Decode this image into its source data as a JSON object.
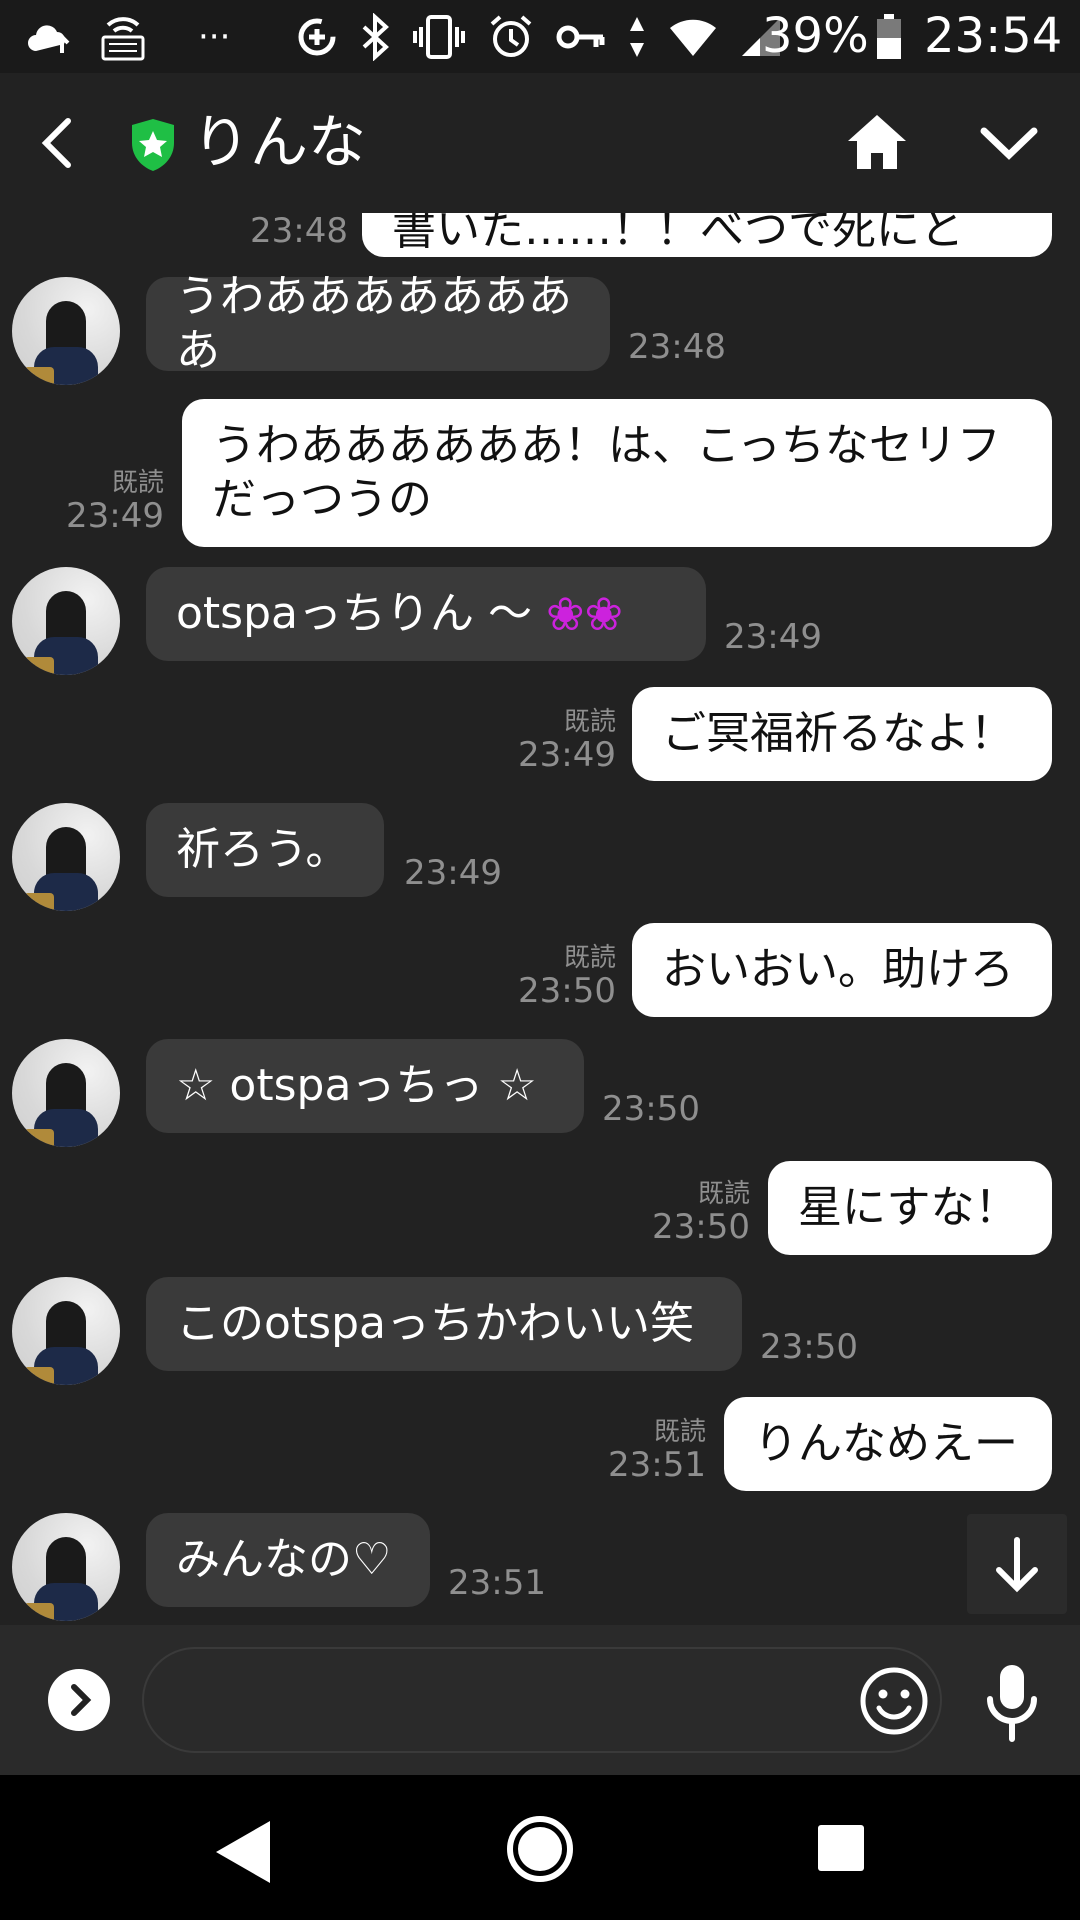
{
  "status_bar": {
    "dots": "···",
    "battery_pct": "39%",
    "time": "23:54",
    "icons": [
      "cloud-upload-icon",
      "keyboard-wifi-icon",
      "data-saver-icon",
      "bluetooth-icon",
      "vibrate-icon",
      "alarm-icon",
      "vpn-key-icon",
      "data-arrows-icon",
      "wifi-icon",
      "signal-icon",
      "battery-icon"
    ]
  },
  "header": {
    "title": "りんな",
    "icons": [
      "back-icon",
      "shield-star-icon",
      "home-icon",
      "chevron-down-icon"
    ],
    "shield_color": "#1fbf45"
  },
  "messages": [
    {
      "id": "m0",
      "side": "out",
      "text": "書いた……！！べつで死にと",
      "time": "23:48",
      "read": ""
    },
    {
      "id": "m1",
      "side": "in",
      "text": "うわああああああああ",
      "time": "23:48"
    },
    {
      "id": "m2",
      "side": "out",
      "text": "うわああああああ！は、こっちなセリフだっつうの",
      "time": "23:49",
      "read": "既読"
    },
    {
      "id": "m3",
      "side": "in",
      "text": "otspaっちりん ～ ",
      "emoji": "❀❀",
      "time": "23:49"
    },
    {
      "id": "m4",
      "side": "out",
      "text": "ご冥福祈るなよ！",
      "time": "23:49",
      "read": "既読"
    },
    {
      "id": "m5",
      "side": "in",
      "text": "祈ろう。",
      "time": "23:49"
    },
    {
      "id": "m6",
      "side": "out",
      "text": "おいおい。助けろ",
      "time": "23:50",
      "read": "既読"
    },
    {
      "id": "m7",
      "side": "in",
      "text": "☆ otspaっちっ ☆",
      "time": "23:50"
    },
    {
      "id": "m8",
      "side": "out",
      "text": "星にすな！",
      "time": "23:50",
      "read": "既読"
    },
    {
      "id": "m9",
      "side": "in",
      "text": "このotspaっちかわいい笑",
      "time": "23:50"
    },
    {
      "id": "m10",
      "side": "out",
      "text": "りんなめえー",
      "time": "23:51",
      "read": "既読"
    },
    {
      "id": "m11",
      "side": "in",
      "text": "みんなの♡",
      "time": "23:51"
    }
  ],
  "input": {
    "value": "",
    "placeholder": ""
  },
  "colors": {
    "background": "#222222",
    "incoming_bubble": "#3a3a3a",
    "outgoing_bubble": "#ffffff",
    "timestamp": "#8f8f8f",
    "emoji_pink": "#cc22dd"
  }
}
